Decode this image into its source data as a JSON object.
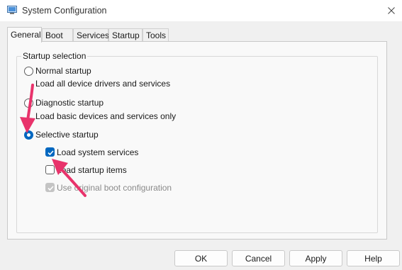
{
  "window": {
    "title": "System Configuration",
    "icon": "msconfig-app-icon"
  },
  "tabs": [
    {
      "label": "General",
      "active": true
    },
    {
      "label": "Boot",
      "active": false
    },
    {
      "label": "Services",
      "active": false
    },
    {
      "label": "Startup",
      "active": false
    },
    {
      "label": "Tools",
      "active": false
    }
  ],
  "startup_selection": {
    "group_title": "Startup selection",
    "normal": {
      "label": "Normal startup",
      "description": "Load all device drivers and services",
      "selected": false
    },
    "diagnostic": {
      "label": "Diagnostic startup",
      "description": "Load basic devices and services only",
      "selected": false
    },
    "selective": {
      "label": "Selective startup",
      "selected": true
    },
    "options": {
      "load_system_services": {
        "label": "Load system services",
        "checked": true,
        "enabled": true
      },
      "load_startup_items": {
        "label": "Load startup items",
        "checked": false,
        "enabled": true
      },
      "use_original_boot": {
        "label": "Use original boot configuration",
        "checked": true,
        "enabled": false
      }
    }
  },
  "buttons": {
    "ok": "OK",
    "cancel": "Cancel",
    "apply": "Apply",
    "help": "Help"
  },
  "annotation_color": "#e8336b",
  "accent_color": "#0067c0"
}
